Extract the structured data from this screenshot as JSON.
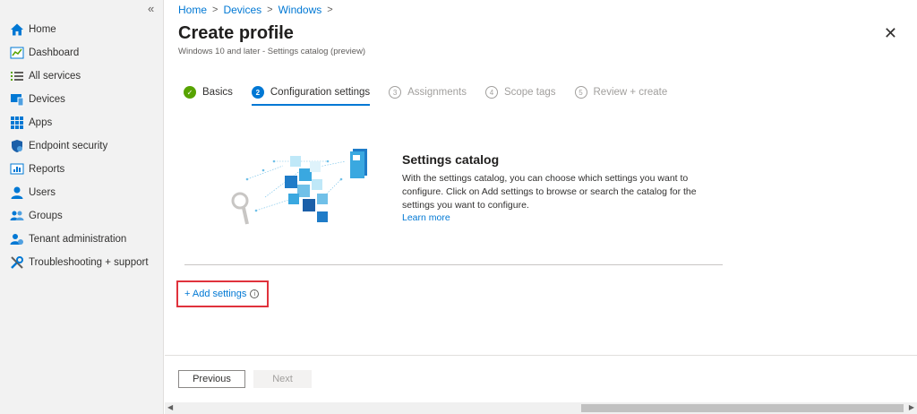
{
  "sidebar": {
    "collapse_icon": "«",
    "items": [
      {
        "label": "Home",
        "icon": "home-icon"
      },
      {
        "label": "Dashboard",
        "icon": "dashboard-icon"
      },
      {
        "label": "All services",
        "icon": "list-icon"
      },
      {
        "label": "Devices",
        "icon": "devices-icon"
      },
      {
        "label": "Apps",
        "icon": "apps-icon"
      },
      {
        "label": "Endpoint security",
        "icon": "shield-icon"
      },
      {
        "label": "Reports",
        "icon": "reports-icon"
      },
      {
        "label": "Users",
        "icon": "user-icon"
      },
      {
        "label": "Groups",
        "icon": "groups-icon"
      },
      {
        "label": "Tenant administration",
        "icon": "tenant-icon"
      },
      {
        "label": "Troubleshooting + support",
        "icon": "wrench-icon"
      }
    ]
  },
  "breadcrumb": [
    "Home",
    "Devices",
    "Windows"
  ],
  "header": {
    "title": "Create profile",
    "more": "···",
    "subtitle": "Windows 10 and later - Settings catalog (preview)",
    "close": "✕"
  },
  "steps": [
    {
      "num": "✓",
      "label": "Basics",
      "state": "done"
    },
    {
      "num": "2",
      "label": "Configuration settings",
      "state": "active"
    },
    {
      "num": "3",
      "label": "Assignments",
      "state": "future"
    },
    {
      "num": "4",
      "label": "Scope tags",
      "state": "future"
    },
    {
      "num": "5",
      "label": "Review + create",
      "state": "future"
    }
  ],
  "catalog": {
    "title": "Settings catalog",
    "description": "With the settings catalog, you can choose which settings you want to configure. Click on Add settings to browse or search the catalog for the settings you want to configure.",
    "learn_more": "Learn more"
  },
  "add_settings": {
    "label": "+ Add settings",
    "info": "i"
  },
  "footer": {
    "previous": "Previous",
    "next": "Next"
  },
  "colors": {
    "accent": "#0078d4",
    "highlight": "#e0323c",
    "done": "#57a300"
  }
}
